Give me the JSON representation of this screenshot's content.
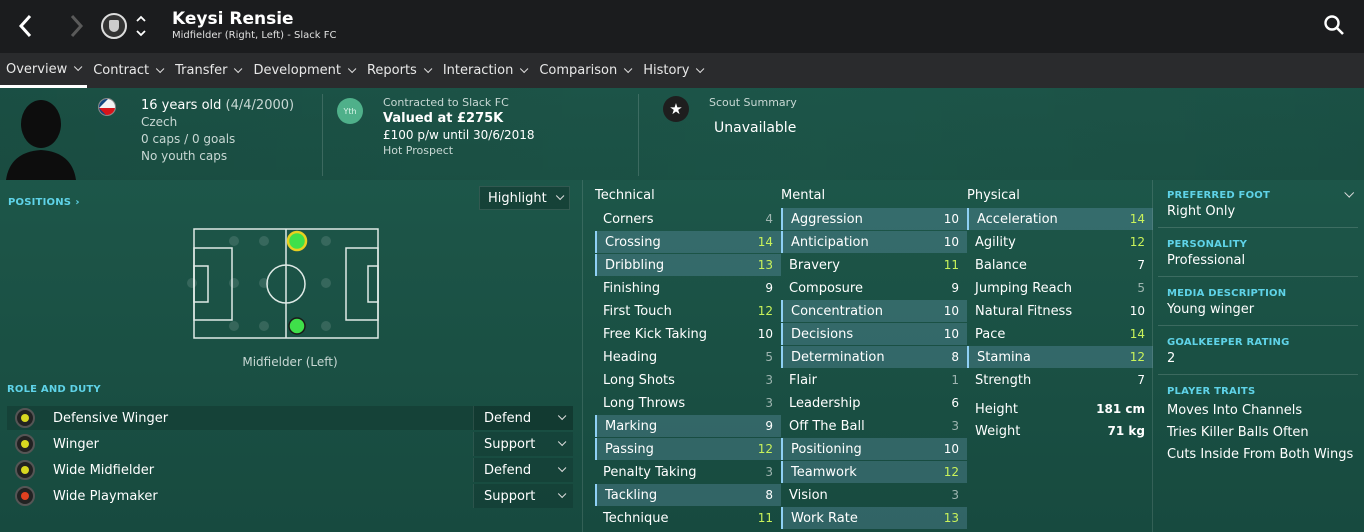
{
  "header": {
    "player_name": "Keysi Rensie",
    "subtitle": "Midfielder (Right, Left) - Slack FC"
  },
  "tabs": [
    {
      "label": "Overview"
    },
    {
      "label": "Contract"
    },
    {
      "label": "Transfer"
    },
    {
      "label": "Development"
    },
    {
      "label": "Reports"
    },
    {
      "label": "Interaction"
    },
    {
      "label": "Comparison"
    },
    {
      "label": "History"
    }
  ],
  "info": {
    "age_line": "16 years old",
    "dob": "(4/4/2000)",
    "nationality": "Czech",
    "caps": "0 caps / 0 goals",
    "youth_caps": "No youth caps",
    "badge": "Yth",
    "contract_label": "Contracted to Slack FC",
    "value": "Valued at £275K",
    "wage": "£100 p/w until 30/6/2018",
    "status": "Hot Prospect",
    "scout_label": "Scout Summary",
    "scout_value": "Unavailable"
  },
  "positions": {
    "header": "POSITIONS",
    "highlight_label": "Highlight",
    "position_label": "Midfielder (Left)"
  },
  "roles": {
    "header": "ROLE AND DUTY",
    "items": [
      {
        "role": "Defensive Winger",
        "duty": "Defend",
        "color": "#d8d820"
      },
      {
        "role": "Winger",
        "duty": "Support",
        "color": "#d8d820"
      },
      {
        "role": "Wide Midfielder",
        "duty": "Defend",
        "color": "#d8d820"
      },
      {
        "role": "Wide Playmaker",
        "duty": "Support",
        "color": "#e04020"
      }
    ]
  },
  "attributes": {
    "technical_header": "Technical",
    "mental_header": "Mental",
    "physical_header": "Physical",
    "technical": [
      {
        "name": "Corners",
        "value": "4"
      },
      {
        "name": "Crossing",
        "value": "14"
      },
      {
        "name": "Dribbling",
        "value": "13"
      },
      {
        "name": "Finishing",
        "value": "9"
      },
      {
        "name": "First Touch",
        "value": "12"
      },
      {
        "name": "Free Kick Taking",
        "value": "10"
      },
      {
        "name": "Heading",
        "value": "5"
      },
      {
        "name": "Long Shots",
        "value": "3"
      },
      {
        "name": "Long Throws",
        "value": "3"
      },
      {
        "name": "Marking",
        "value": "9"
      },
      {
        "name": "Passing",
        "value": "12"
      },
      {
        "name": "Penalty Taking",
        "value": "3"
      },
      {
        "name": "Tackling",
        "value": "8"
      },
      {
        "name": "Technique",
        "value": "11"
      }
    ],
    "mental": [
      {
        "name": "Aggression",
        "value": "10"
      },
      {
        "name": "Anticipation",
        "value": "10"
      },
      {
        "name": "Bravery",
        "value": "11"
      },
      {
        "name": "Composure",
        "value": "9"
      },
      {
        "name": "Concentration",
        "value": "10"
      },
      {
        "name": "Decisions",
        "value": "10"
      },
      {
        "name": "Determination",
        "value": "8"
      },
      {
        "name": "Flair",
        "value": "1"
      },
      {
        "name": "Leadership",
        "value": "6"
      },
      {
        "name": "Off The Ball",
        "value": "3"
      },
      {
        "name": "Positioning",
        "value": "10"
      },
      {
        "name": "Teamwork",
        "value": "12"
      },
      {
        "name": "Vision",
        "value": "3"
      },
      {
        "name": "Work Rate",
        "value": "13"
      }
    ],
    "physical": [
      {
        "name": "Acceleration",
        "value": "14"
      },
      {
        "name": "Agility",
        "value": "12"
      },
      {
        "name": "Balance",
        "value": "7"
      },
      {
        "name": "Jumping Reach",
        "value": "5"
      },
      {
        "name": "Natural Fitness",
        "value": "10"
      },
      {
        "name": "Pace",
        "value": "14"
      },
      {
        "name": "Stamina",
        "value": "12"
      },
      {
        "name": "Strength",
        "value": "7"
      }
    ],
    "height_label": "Height",
    "height_value": "181 cm",
    "weight_label": "Weight",
    "weight_value": "71 kg"
  },
  "side": {
    "preferred_foot_label": "PREFERRED FOOT",
    "preferred_foot": "Right Only",
    "personality_label": "PERSONALITY",
    "personality": "Professional",
    "media_label": "MEDIA DESCRIPTION",
    "media": "Young winger",
    "gk_label": "GOALKEEPER RATING",
    "gk": "2",
    "traits_label": "PLAYER TRAITS",
    "traits": [
      "Moves Into Channels",
      "Tries Killer Balls Often",
      "Cuts Inside From Both Wings"
    ]
  }
}
